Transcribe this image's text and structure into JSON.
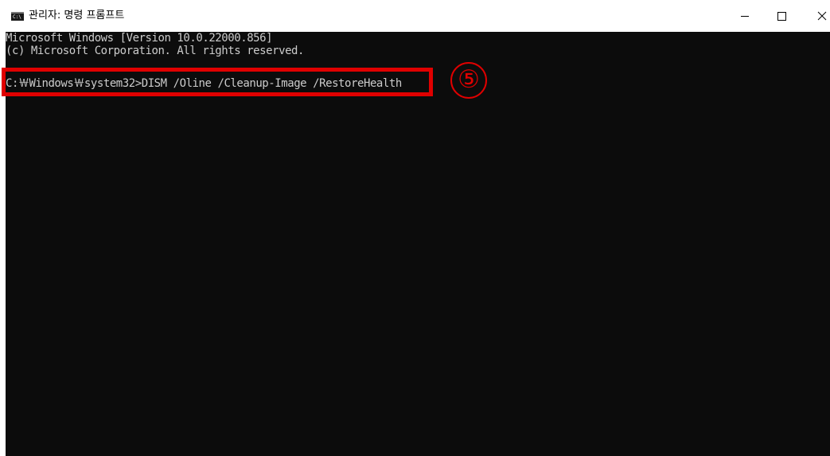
{
  "window": {
    "title": "관리자: 명령 프롬프트",
    "icon": "cmd-icon"
  },
  "titlebar": {
    "minimize_icon": "minimize-icon",
    "maximize_icon": "maximize-icon",
    "close_icon": "close-icon"
  },
  "console": {
    "lines": [
      "Microsoft Windows [Version 10.0.22000.856]",
      "(c) Microsoft Corporation. All rights reserved.",
      "C:￦Windows￦system32>DISM /Oline /Cleanup-Image /RestoreHealth"
    ],
    "background": "#0c0c0c",
    "foreground": "#cccccc"
  },
  "annotation": {
    "step_label": "⑤",
    "color": "#e00000"
  }
}
